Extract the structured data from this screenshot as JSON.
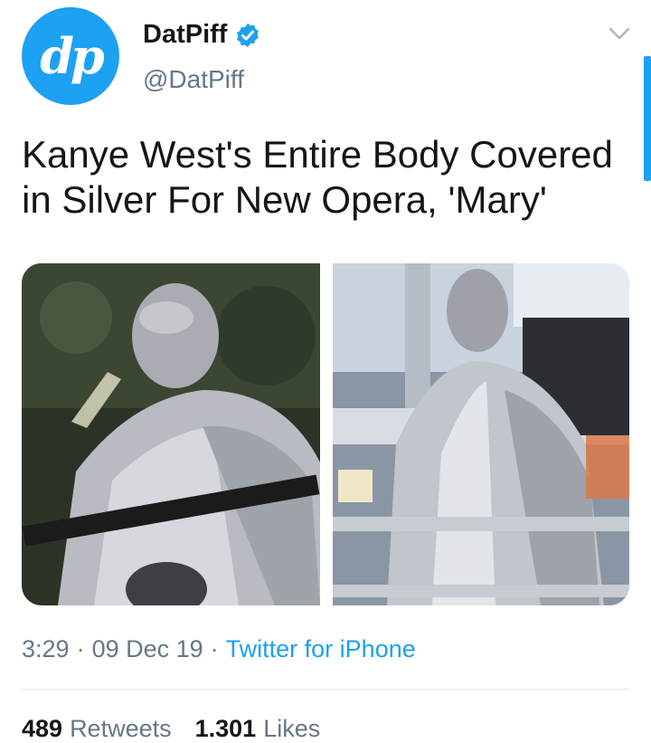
{
  "author": {
    "avatar_text": "dp",
    "name": "DatPiff",
    "handle": "@DatPiff",
    "verified": true
  },
  "tweet": {
    "text": "Kanye West's Entire Body Covered in Silver For New Opera, 'Mary'"
  },
  "media": [
    {
      "label": "photo-1"
    },
    {
      "label": "photo-2"
    }
  ],
  "meta": {
    "time": "3:29",
    "separator": "·",
    "date": "09 Dec 19",
    "source": "Twitter for iPhone"
  },
  "stats": {
    "retweets_count": "489",
    "retweets_label": "Retweets",
    "likes_count": "1.301",
    "likes_label": "Likes"
  },
  "colors": {
    "accent": "#1da1f2",
    "text": "#14171a",
    "muted": "#657786"
  }
}
